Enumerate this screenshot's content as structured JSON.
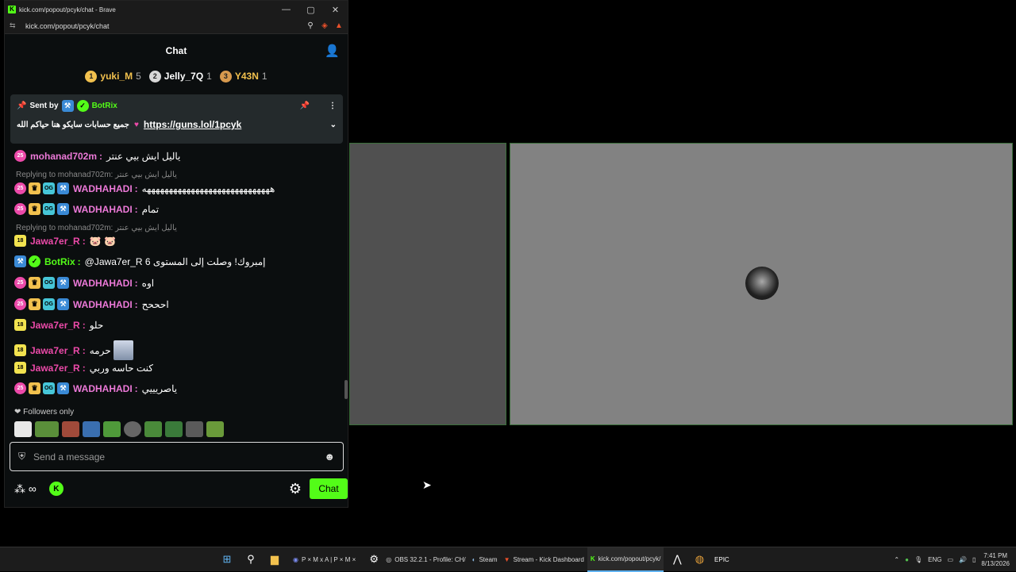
{
  "browser": {
    "title": "kick.com/popout/pcyk/chat - Brave",
    "url": "kick.com/popout/pcyk/chat",
    "favicon_text": "K",
    "window_controls": [
      "—",
      "▢",
      "✕"
    ]
  },
  "chat": {
    "header_title": "Chat",
    "leaderboard": [
      {
        "rank": "1",
        "name": "yuki_M",
        "count": "5",
        "color": "#f2c14e",
        "name_color": "#f2c14e"
      },
      {
        "rank": "2",
        "name": "Jelly_7Q",
        "count": "1",
        "color": "#d8d8d8",
        "name_color": "#ffffff"
      },
      {
        "rank": "3",
        "name": "Y43N",
        "count": "1",
        "color": "#d89a4e",
        "name_color": "#f2c14e"
      }
    ],
    "pinned": {
      "sent_by_label": "Sent by",
      "sender": "BotRix",
      "message": "جميع حسابات سايكو هنا حياكم الله",
      "link": "https://guns.lol/1pcyk"
    },
    "messages": [
      {
        "user": "mohanad702m",
        "text": "ياليل ايش بيي عنتر",
        "color": "#ec79d8",
        "badges": [
          "sub"
        ]
      },
      {
        "reply": "Replying to mohanad702m: ياليل ايش بيي عنتر"
      },
      {
        "user": "WADHAHADI",
        "text": "هههههههههههههههههههههههههههههه",
        "color": "#ec79d8",
        "badges": [
          "sub",
          "crown",
          "og",
          "bot"
        ]
      },
      {
        "user": "WADHAHADI",
        "text": "تمام",
        "color": "#ec79d8",
        "badges": [
          "sub",
          "crown",
          "og",
          "bot"
        ]
      },
      {
        "reply": "Replying to mohanad702m: ياليل ايش بيي عنتر"
      },
      {
        "user": "Jawa7er_R",
        "text": "🐷 🐷",
        "color": "#ec4aa9",
        "badges": [
          "18"
        ]
      },
      {
        "user": "BotRix",
        "text": "@Jawa7er_R إمبروك! وصلت إلى المستوى 6",
        "color": "#53fc18",
        "badges": [
          "bot",
          "verified"
        ]
      },
      {
        "user": "WADHAHADI",
        "text": "اوه",
        "color": "#ec79d8",
        "badges": [
          "sub",
          "crown",
          "og",
          "bot"
        ]
      },
      {
        "user": "WADHAHADI",
        "text": "احححح",
        "color": "#ec79d8",
        "badges": [
          "sub",
          "crown",
          "og",
          "bot"
        ]
      },
      {
        "user": "Jawa7er_R",
        "text": "حلو",
        "color": "#ec4aa9",
        "badges": [
          "18"
        ]
      },
      {
        "user": "Jawa7er_R",
        "text": "حرمه",
        "color": "#ec4aa9",
        "badges": [
          "18"
        ],
        "emote": true
      },
      {
        "user": "Jawa7er_R",
        "text": "كنت حاسه وربي",
        "color": "#ec4aa9",
        "badges": [
          "18"
        ]
      },
      {
        "user": "WADHAHADI",
        "text": "ياصريييي",
        "color": "#ec79d8",
        "badges": [
          "sub",
          "crown",
          "og",
          "bot"
        ]
      }
    ],
    "badge_labels": {
      "sub": "25",
      "18": "18",
      "crown": "♛",
      "og": "OG",
      "bot": "⚒",
      "verified": "✓"
    },
    "followers_only": "Followers only",
    "input_placeholder": "Send a message",
    "footer": {
      "kicks": "∞",
      "send_label": "Chat"
    }
  },
  "taskbar": {
    "apps": [
      {
        "label": "P × M x A | P × M ×",
        "icon": "discord-icon",
        "active": false
      },
      {
        "label": "OBS 32.2.1 - Profile: CH/",
        "icon": "obs-icon",
        "active": false
      },
      {
        "label": "Steam",
        "icon": "steam-icon",
        "active": false
      },
      {
        "label": "Stream - Kick Dashboard",
        "icon": "brave-icon",
        "active": false
      },
      {
        "label": "kick.com/popout/pcyk/",
        "icon": "kick-icon",
        "active": true
      }
    ],
    "language": "ENG",
    "time": "7:41 PM",
    "date": "8/13/2026"
  },
  "colors": {
    "kick_green": "#53fc18",
    "panel_border": "#3a6f3a"
  }
}
